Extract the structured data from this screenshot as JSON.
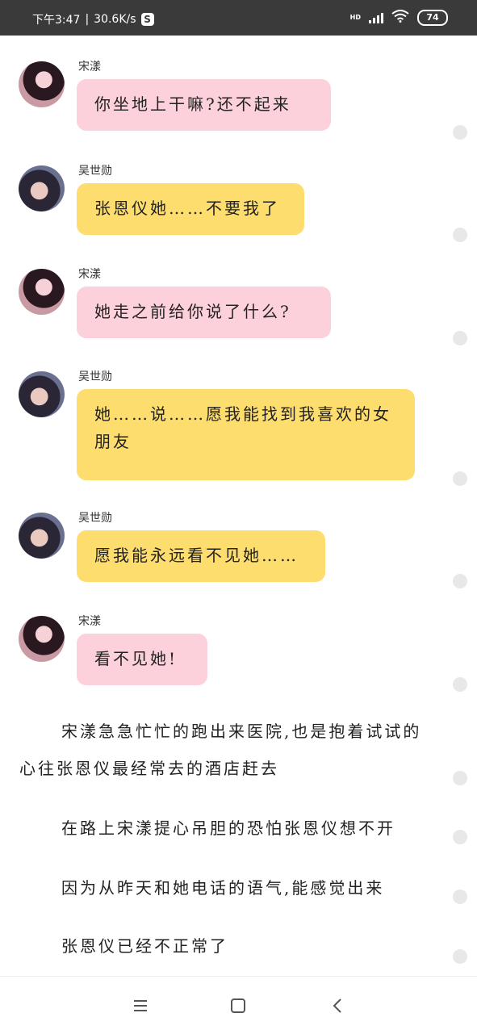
{
  "status_bar": {
    "time": "下午3:47",
    "speed": "30.6K/s",
    "app_badge": "S",
    "network_label": "HD",
    "battery": "74"
  },
  "messages": [
    {
      "sender": "宋漾",
      "text": "你坐地上干嘛?还不起来",
      "color": "#fdd1dc"
    },
    {
      "sender": "吴世勋",
      "text": "张恩仪她……不要我了",
      "color": "#fedd6f"
    },
    {
      "sender": "宋漾",
      "text": "她走之前给你说了什么?",
      "color": "#fdd1dc"
    },
    {
      "sender": "吴世勋",
      "text": "她……说……愿我能找到我喜欢的女朋友",
      "color": "#fedd6f"
    },
    {
      "sender": "吴世勋",
      "text": "愿我能永远看不见她……",
      "color": "#fedd6f"
    },
    {
      "sender": "宋漾",
      "text": "看不见她!",
      "color": "#fdd1dc"
    }
  ],
  "narration": [
    "宋漾急急忙忙的跑出来医院,也是抱着试试的心往张恩仪最经常去的酒店赶去",
    "在路上宋漾提心吊胆的恐怕张恩仪想不开",
    "因为从昨天和她电话的语气,能感觉出来",
    "张恩仪已经不正常了"
  ],
  "nav_bar": {
    "menu_icon": "menu-icon",
    "home_icon": "home-icon",
    "back_icon": "back-icon"
  }
}
